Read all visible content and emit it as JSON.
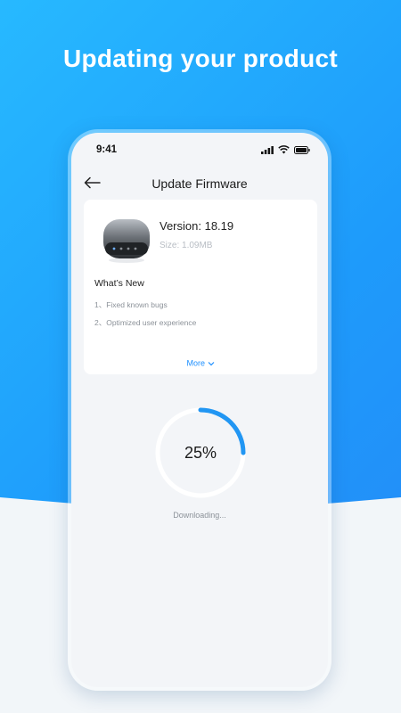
{
  "headline": "Updating your product",
  "status_bar": {
    "time": "9:41"
  },
  "nav": {
    "title": "Update Firmware"
  },
  "firmware": {
    "version_text": "Version: 18.19",
    "size_text": "Size: 1.09MB",
    "whats_new_heading": "What’s New",
    "notes": [
      "1、Fixed known bugs",
      "2、Optimized user experience"
    ],
    "more_label": "More"
  },
  "progress": {
    "percent": 25,
    "label": "25%",
    "status": "Downloading..."
  },
  "colors": {
    "accent": "#1e90ff",
    "progress_track": "#ffffff",
    "progress_fill": "#2196f3"
  },
  "icons": {
    "back": "arrow-left-icon",
    "signal": "signal-icon",
    "wifi": "wifi-icon",
    "battery": "battery-icon",
    "more": "chevron-down-icon"
  }
}
